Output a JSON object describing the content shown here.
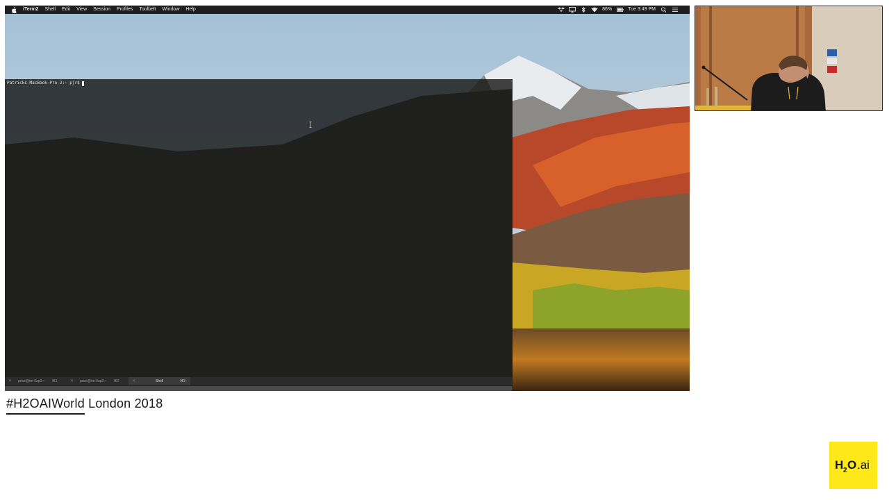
{
  "menubar": {
    "app_name": "iTerm2",
    "items": [
      "Shell",
      "Edit",
      "View",
      "Session",
      "Profiles",
      "Toolbelt",
      "Window",
      "Help"
    ],
    "battery": "86%",
    "clock": "Tue 3:49 PM"
  },
  "terminal": {
    "prompt": "Patricks-MacBook-Pro-2:~ pjr$"
  },
  "tabs": [
    {
      "label": "price@mr-0xp2:~",
      "shortcut": "⌘1"
    },
    {
      "label": "price@mr-0xp2:~",
      "shortcut": "⌘2"
    },
    {
      "label": "Shell",
      "shortcut": "⌘3"
    }
  ],
  "caption": {
    "hashtag": "#H2OAIWorld",
    "rest": " London 2018"
  },
  "logo": {
    "text": "H2O.ai"
  },
  "colors": {
    "logo_bg": "#fde81a",
    "menubar_bg": "#1e1e1e",
    "terminal_bg": "#141414"
  }
}
